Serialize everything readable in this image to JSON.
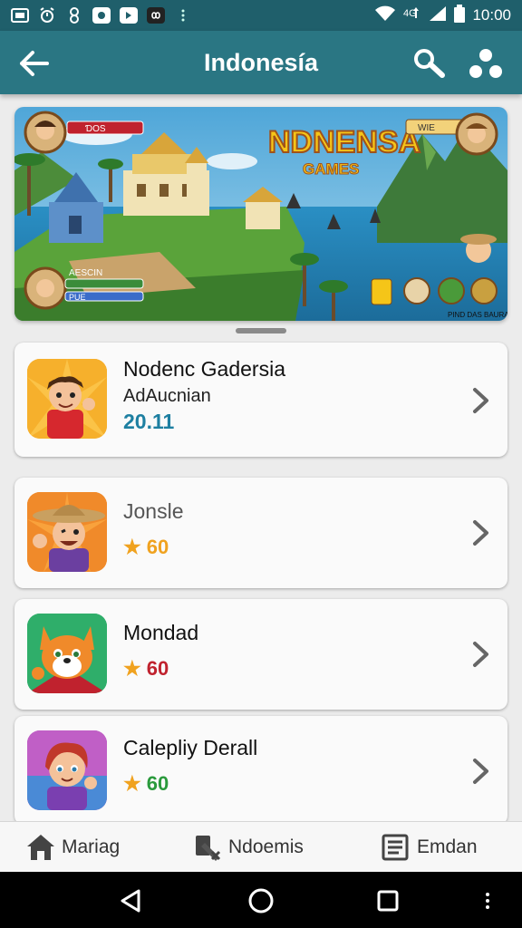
{
  "status_bar": {
    "time": "10:00",
    "icons": [
      "screenshot-icon",
      "alarm-icon",
      "link-icon",
      "message-icon",
      "message-icon",
      "infinity-icon",
      "more-dots-icon"
    ],
    "right_icons": [
      "wifi-icon",
      "data-icon",
      "signal-icon",
      "battery-icon"
    ],
    "data_label": "4G"
  },
  "app_bar": {
    "title": "Indonesía"
  },
  "banner": {
    "headline": "NDNENSA",
    "subheadline": "GAMES",
    "player_label_top": "ƊOS",
    "player_label_right": "WIE",
    "player_label_left": "AESCIN",
    "player_label_left2": "PUE",
    "corner_text": "PIND DAS BAURA"
  },
  "games": [
    {
      "title": "Nodenc Gadersia",
      "subtitle": "AdAucnian",
      "price": "20.11",
      "thumb": "boy-red-shirt"
    },
    {
      "title": "Jonsle",
      "rating": "60",
      "rating_color": "#f0a21f",
      "thumb": "boy-cowboy-hat"
    },
    {
      "title": "Mondad",
      "rating": "60",
      "rating_color": "#c0222e",
      "thumb": "fox"
    },
    {
      "title": "Calepliy Derall",
      "rating": "60",
      "rating_color": "#2a9a3c",
      "thumb": "girl-purple"
    }
  ],
  "bottom_nav": [
    {
      "label": "Mariag",
      "icon": "home-icon"
    },
    {
      "label": "Ndoemis",
      "icon": "tools-icon"
    },
    {
      "label": "Emdan",
      "icon": "list-icon"
    }
  ],
  "colors": {
    "app_bar": "#2a7683",
    "status_bar": "#1f5f6b",
    "price": "#1d7fa1"
  }
}
